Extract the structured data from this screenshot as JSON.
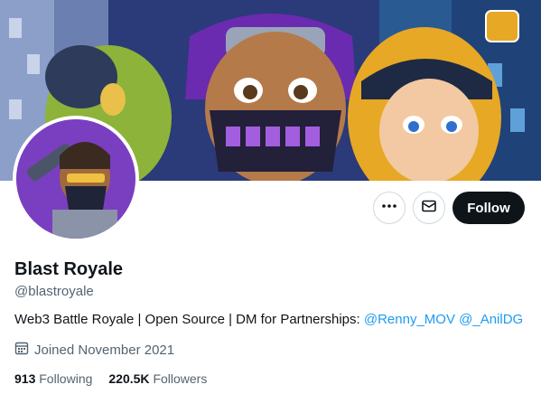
{
  "profile": {
    "name": "Blast Royale",
    "handle": "@blastroyale",
    "bio_text": "Web3 Battle Royale | Open Source | DM for Partnerships: ",
    "bio_mentions": [
      "@Renny_MOV",
      "@_AnilDG"
    ],
    "joined": "Joined November 2021",
    "following_count": "913",
    "following_label": "Following",
    "followers_count": "220.5K",
    "followers_label": "Followers"
  },
  "actions": {
    "more_icon": "more-icon",
    "message_icon": "mail-icon",
    "follow_label": "Follow"
  },
  "colors": {
    "accent": "#1d9bf0",
    "follow_bg": "#0f1419",
    "banner_purple": "#6a2bb0",
    "banner_yellow": "#e7a825"
  }
}
